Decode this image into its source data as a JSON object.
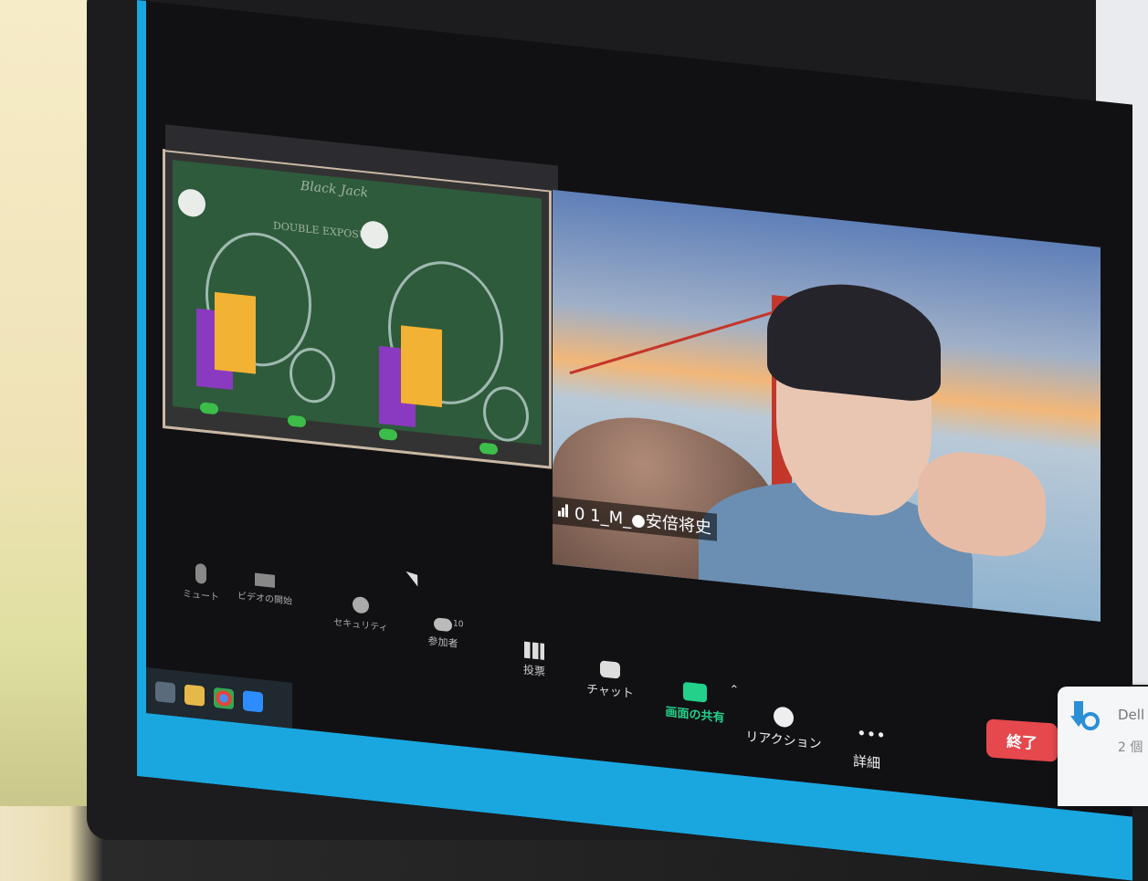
{
  "video": {
    "participant_name": "0 1_M_●安倍将史"
  },
  "toolbar": {
    "mute_label": "ミュート",
    "video_label": "ビデオの開始",
    "security_label": "セキュリティ",
    "participants_label": "参加者",
    "participants_count": "10",
    "polls_label": "投票",
    "chat_label": "チャット",
    "share_label": "画面の共有",
    "reactions_label": "リアクション",
    "more_label": "詳細",
    "end_label": "終了"
  },
  "shared_screen": {
    "game_title": "Black Jack",
    "subtitle": "DOUBLE EXPOSURE"
  },
  "notification": {
    "title": "Dell",
    "body": "2 個"
  },
  "colors": {
    "screen_accent": "#1aa7e0",
    "end_button": "#e5484d",
    "share_icon": "#23d18b",
    "table_green": "#2e5b3b"
  }
}
